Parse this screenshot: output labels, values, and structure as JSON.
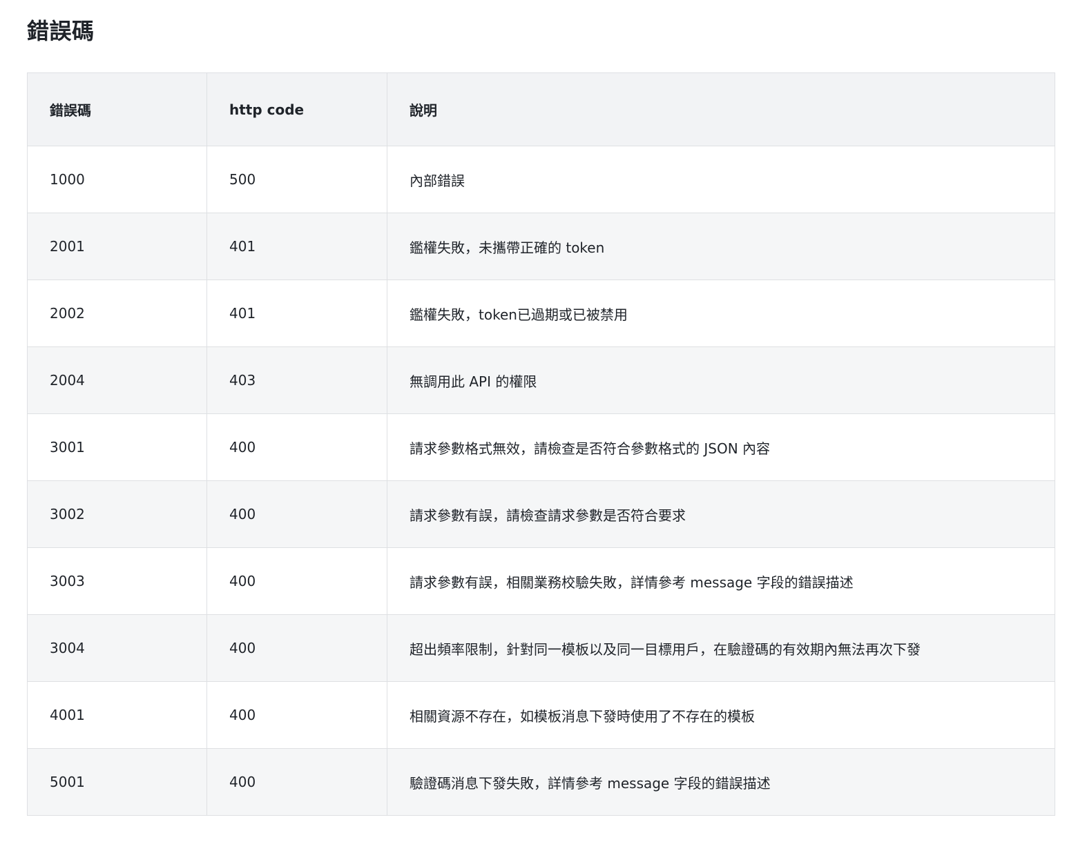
{
  "page": {
    "title": "錯誤碼"
  },
  "table": {
    "headers": {
      "code": "錯誤碼",
      "http": "http code",
      "desc": "說明"
    },
    "rows": [
      {
        "code": "1000",
        "http": "500",
        "desc": "內部錯誤"
      },
      {
        "code": "2001",
        "http": "401",
        "desc": "鑑權失敗，未攜帶正確的 token"
      },
      {
        "code": "2002",
        "http": "401",
        "desc": "鑑權失敗，token已過期或已被禁用"
      },
      {
        "code": "2004",
        "http": "403",
        "desc": "無調用此 API 的權限"
      },
      {
        "code": "3001",
        "http": "400",
        "desc": "請求參數格式無效，請檢查是否符合參數格式的 JSON 內容"
      },
      {
        "code": "3002",
        "http": "400",
        "desc": "請求參數有誤，請檢查請求參數是否符合要求"
      },
      {
        "code": "3003",
        "http": "400",
        "desc": "請求參數有誤，相關業務校驗失敗，詳情參考 message 字段的錯誤描述"
      },
      {
        "code": "3004",
        "http": "400",
        "desc": "超出頻率限制，針對同一模板以及同一目標用戶，在驗證碼的有效期內無法再次下發"
      },
      {
        "code": "4001",
        "http": "400",
        "desc": "相關資源不存在，如模板消息下發時使用了不存在的模板"
      },
      {
        "code": "5001",
        "http": "400",
        "desc": "驗證碼消息下發失敗，詳情參考 message 字段的錯誤描述"
      }
    ]
  }
}
